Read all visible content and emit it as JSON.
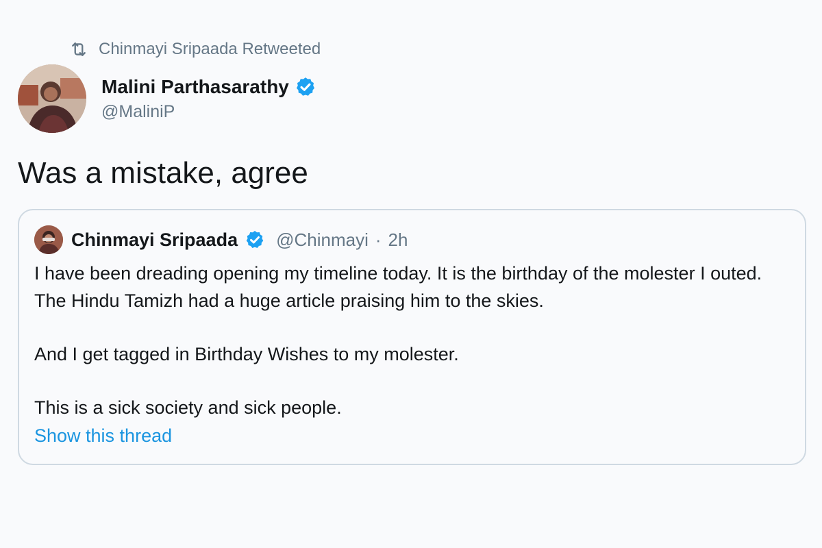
{
  "retweet": {
    "icon": "retweet-icon",
    "label": "Chinmayi Sripaada Retweeted"
  },
  "tweet": {
    "author_name": "Malini Parthasarathy",
    "author_handle": "@MaliniP",
    "verified": true,
    "text": "Was a mistake, agree"
  },
  "quoted_tweet": {
    "author_name": "Chinmayi Sripaada",
    "author_handle": "@Chinmayi",
    "separator": "·",
    "time": "2h",
    "verified": true,
    "paragraphs": [
      "I have been dreading opening my timeline today. It is the birthday of the molester I outed. The Hindu Tamizh had a huge article praising him to the skies.",
      "And I get tagged in Birthday Wishes to my molester.",
      "This is a sick society and sick people."
    ],
    "show_thread_label": "Show this thread"
  },
  "colors": {
    "background": "#f9fafc",
    "text_primary": "#14171a",
    "text_secondary": "#657786",
    "link": "#1b95e0",
    "verified_badge": "#1da1f2",
    "card_border": "#cfd9e2"
  }
}
